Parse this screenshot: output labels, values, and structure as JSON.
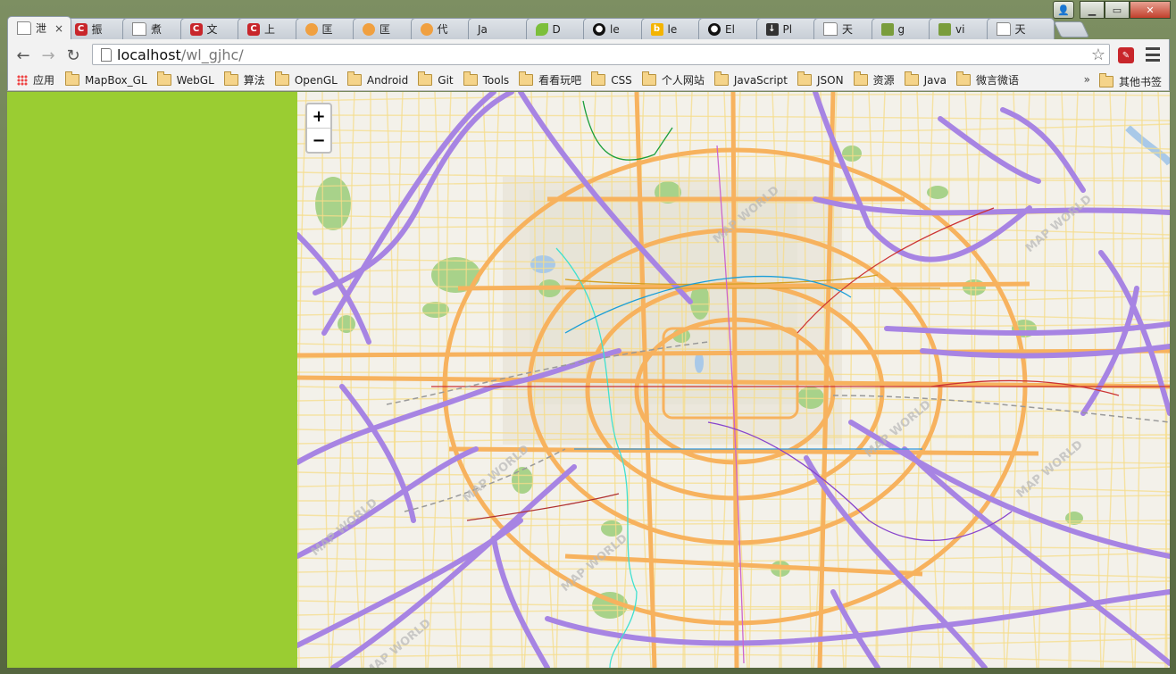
{
  "tabs": [
    {
      "title": "泄",
      "icon": "doc",
      "active": true
    },
    {
      "title": "振",
      "icon": "c"
    },
    {
      "title": "煮",
      "icon": "doc"
    },
    {
      "title": "文",
      "icon": "c"
    },
    {
      "title": "上",
      "icon": "c"
    },
    {
      "title": "匡",
      "icon": "orange"
    },
    {
      "title": "匡",
      "icon": "orange"
    },
    {
      "title": "代",
      "icon": "orange"
    },
    {
      "title": "Ja",
      "icon": "none"
    },
    {
      "title": "D",
      "icon": "leaf"
    },
    {
      "title": "le",
      "icon": "gh"
    },
    {
      "title": "le",
      "icon": "bing"
    },
    {
      "title": "El",
      "icon": "gh"
    },
    {
      "title": "Pl",
      "icon": "dl"
    },
    {
      "title": "天",
      "icon": "doc"
    },
    {
      "title": "g",
      "icon": "map"
    },
    {
      "title": "vi",
      "icon": "map"
    },
    {
      "title": "天",
      "icon": "doc"
    }
  ],
  "tab_close": "×",
  "toolbar": {
    "back": "←",
    "forward": "→",
    "reload": "↻",
    "url_host": "localhost",
    "url_path": "/wl_gjhc/",
    "star": "☆"
  },
  "bookmarks": {
    "apps_label": "应用",
    "items": [
      "MapBox_GL",
      "WebGL",
      "算法",
      "OpenGL",
      "Android",
      "Git",
      "Tools",
      "看看玩吧",
      "CSS",
      "个人网站",
      "JavaScript",
      "JSON",
      "资源",
      "Java",
      "微言微语"
    ],
    "more": "»",
    "other": "其他书签"
  },
  "map": {
    "zoom_in": "+",
    "zoom_out": "−",
    "watermark": "MAP WORLD",
    "colors": {
      "expressway": "#a784e3",
      "arterial": "#f7b25e",
      "minor": "#f6dc8a",
      "park": "#a8d28a",
      "water": "#a9c9e8"
    }
  },
  "sidebar_color": "#9acd32"
}
